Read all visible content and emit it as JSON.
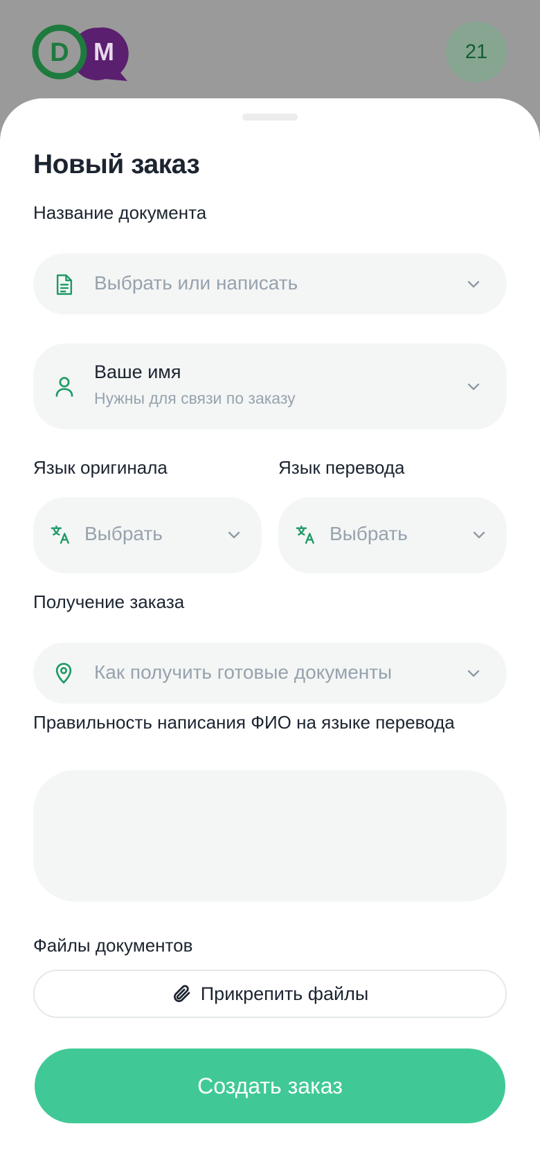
{
  "header": {
    "logo_letter_left": "D",
    "logo_letter_right": "M",
    "notification_count": "21"
  },
  "sheet": {
    "title": "Новый заказ",
    "document_name": {
      "label": "Название документа",
      "placeholder": "Выбрать или написать",
      "icon": "document-icon"
    },
    "name": {
      "value": "Ваше имя",
      "hint": "Нужны для связи по заказу",
      "icon": "user-icon"
    },
    "source_language": {
      "label": "Язык оригинала",
      "placeholder": "Выбрать",
      "icon": "translate-icon"
    },
    "target_language": {
      "label": "Язык перевода",
      "placeholder": "Выбрать",
      "icon": "translate-icon"
    },
    "delivery": {
      "label": "Получение заказа",
      "placeholder": "Как получить готовые документы",
      "icon": "location-pin-icon"
    },
    "fio_spelling": {
      "label": "Правильность написания ФИО на языке перевода",
      "value": ""
    },
    "files": {
      "label": "Файлы документов",
      "button_label": "Прикрепить файлы",
      "icon": "paperclip-icon"
    },
    "submit_label": "Создать заказ"
  },
  "colors": {
    "accent": "#40c996",
    "icon_green": "#1f9a66",
    "logo_green": "#1f7a3e",
    "logo_purple": "#5a1f6e",
    "field_bg": "#f4f6f5",
    "placeholder": "#97a2ae",
    "text": "#1c2430"
  }
}
